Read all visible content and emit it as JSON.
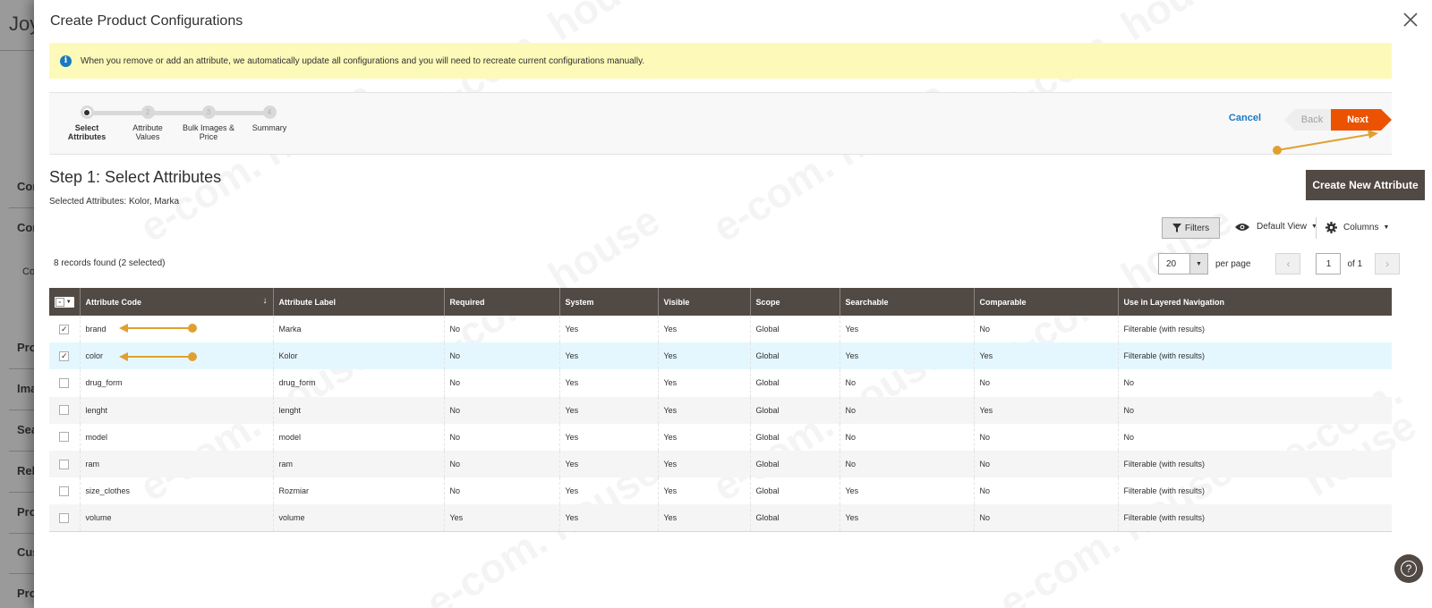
{
  "background": {
    "logo_text": "JoyF",
    "menu_items": [
      "Con",
      "Con",
      "Co",
      "Pro",
      "Ima",
      "Sea",
      "Rela",
      "Pro",
      "Cus",
      "Pro"
    ]
  },
  "modal": {
    "title": "Create Product Configurations",
    "notice": "When you remove or add an attribute, we automatically update all configurations and you will need to recreate current configurations manually.",
    "wizard": {
      "steps": [
        {
          "number": "1",
          "label_line1": "Select",
          "label_line2": "Attributes"
        },
        {
          "number": "2",
          "label_line1": "Attribute",
          "label_line2": "Values"
        },
        {
          "number": "3",
          "label_line1": "Bulk Images &",
          "label_line2": "Price"
        },
        {
          "number": "4",
          "label_line1": "Summary",
          "label_line2": ""
        }
      ],
      "cancel_label": "Cancel",
      "back_label": "Back",
      "next_label": "Next"
    },
    "step_title": "Step 1: Select Attributes",
    "selected_attributes": "Selected Attributes: Kolor, Marka",
    "create_button_label": "Create New Attribute",
    "toolbar": {
      "filters_label": "Filters",
      "view_label": "Default View",
      "columns_label": "Columns"
    },
    "records_found": "8 records found (2 selected)",
    "pager": {
      "per_page_value": "20",
      "per_page_label": "per page",
      "current_page": "1",
      "total_pages": "of 1"
    },
    "grid": {
      "columns": [
        "Attribute Code",
        "Attribute Label",
        "Required",
        "System",
        "Visible",
        "Scope",
        "Searchable",
        "Comparable",
        "Use in Layered Navigation"
      ],
      "rows": [
        {
          "checked": true,
          "code": "brand",
          "label": "Marka",
          "required": "No",
          "system": "Yes",
          "visible": "Yes",
          "scope": "Global",
          "searchable": "Yes",
          "comparable": "No",
          "layered": "Filterable (with results)"
        },
        {
          "checked": true,
          "code": "color",
          "label": "Kolor",
          "required": "No",
          "system": "Yes",
          "visible": "Yes",
          "scope": "Global",
          "searchable": "Yes",
          "comparable": "Yes",
          "layered": "Filterable (with results)"
        },
        {
          "checked": false,
          "code": "drug_form",
          "label": "drug_form",
          "required": "No",
          "system": "Yes",
          "visible": "Yes",
          "scope": "Global",
          "searchable": "No",
          "comparable": "No",
          "layered": "No"
        },
        {
          "checked": false,
          "code": "lenght",
          "label": "lenght",
          "required": "No",
          "system": "Yes",
          "visible": "Yes",
          "scope": "Global",
          "searchable": "No",
          "comparable": "Yes",
          "layered": "No"
        },
        {
          "checked": false,
          "code": "model",
          "label": "model",
          "required": "No",
          "system": "Yes",
          "visible": "Yes",
          "scope": "Global",
          "searchable": "No",
          "comparable": "No",
          "layered": "No"
        },
        {
          "checked": false,
          "code": "ram",
          "label": "ram",
          "required": "No",
          "system": "Yes",
          "visible": "Yes",
          "scope": "Global",
          "searchable": "No",
          "comparable": "No",
          "layered": "Filterable (with results)"
        },
        {
          "checked": false,
          "code": "size_clothes",
          "label": "Rozmiar",
          "required": "No",
          "system": "Yes",
          "visible": "Yes",
          "scope": "Global",
          "searchable": "Yes",
          "comparable": "No",
          "layered": "Filterable (with results)"
        },
        {
          "checked": false,
          "code": "volume",
          "label": "volume",
          "required": "Yes",
          "system": "Yes",
          "visible": "Yes",
          "scope": "Global",
          "searchable": "Yes",
          "comparable": "No",
          "layered": "Filterable (with results)"
        }
      ]
    },
    "help_label": "?",
    "watermark_text": "e-com. house"
  },
  "colors": {
    "accent_orange": "#eb5202",
    "header_brown": "#514943",
    "link_blue": "#1979c3",
    "notice_yellow": "#fdfab9",
    "annotation_gold": "#e0a030"
  }
}
